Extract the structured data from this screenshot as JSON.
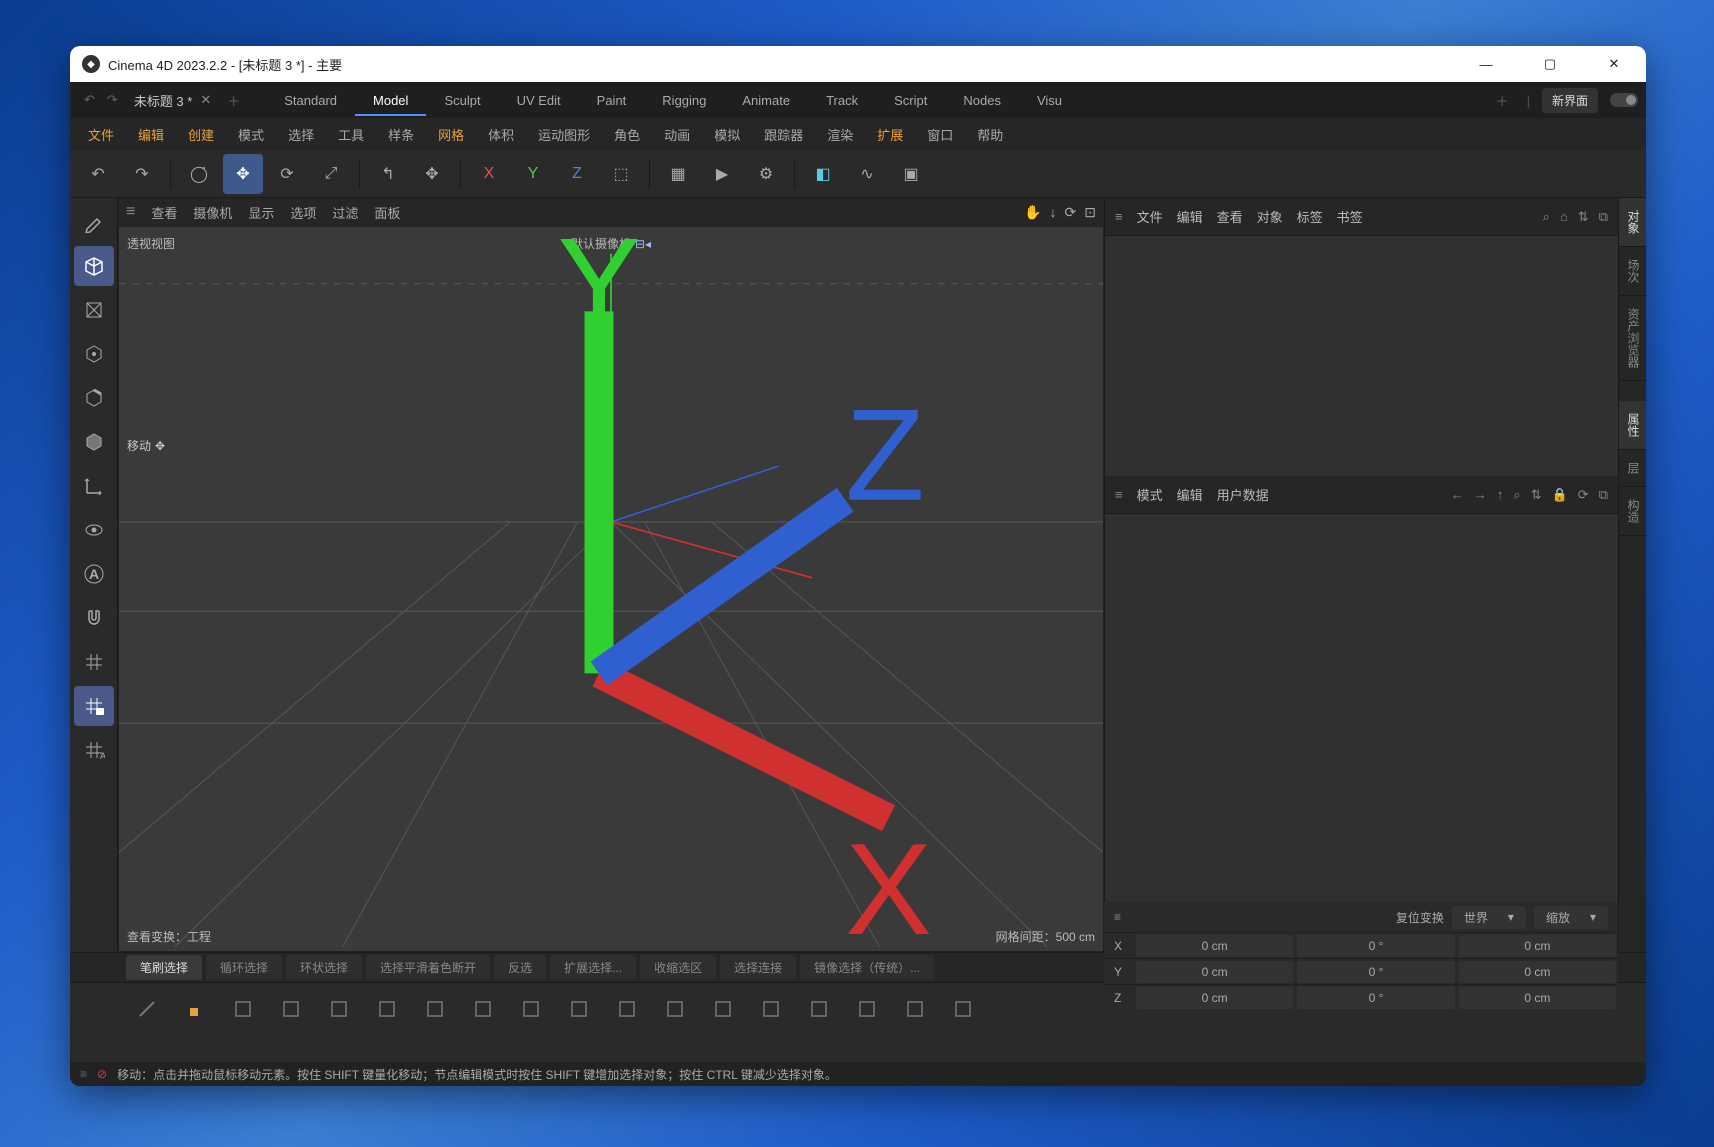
{
  "titlebar": {
    "title": "Cinema 4D 2023.2.2 - [未标题 3 *] - 主要"
  },
  "topTabs": {
    "fileTab": "未标题 3 *",
    "items": [
      "Standard",
      "Model",
      "Sculpt",
      "UV Edit",
      "Paint",
      "Rigging",
      "Animate",
      "Track",
      "Script",
      "Nodes",
      "Visu"
    ],
    "activeIndex": 1,
    "newUiLabel": "新界面"
  },
  "menubar": {
    "items": [
      "文件",
      "编辑",
      "创建",
      "模式",
      "选择",
      "工具",
      "样条",
      "网格",
      "体积",
      "运动图形",
      "角色",
      "动画",
      "模拟",
      "跟踪器",
      "渲染",
      "扩展",
      "窗口",
      "帮助"
    ],
    "orangeIndices": [
      0,
      1,
      2,
      7,
      15
    ]
  },
  "toolbar": {
    "buttons": [
      {
        "name": "undo",
        "glyph": "↶"
      },
      {
        "name": "redo",
        "glyph": "↷"
      },
      {
        "name": "sep"
      },
      {
        "name": "live-select",
        "glyph": "◯̇"
      },
      {
        "name": "move",
        "glyph": "✥",
        "active": true
      },
      {
        "name": "rotate",
        "glyph": "⟳"
      },
      {
        "name": "scale",
        "glyph": "⤢"
      },
      {
        "name": "sep"
      },
      {
        "name": "last-tool",
        "glyph": "↰"
      },
      {
        "name": "axis-move",
        "glyph": "✥"
      },
      {
        "name": "sep"
      },
      {
        "name": "x-axis",
        "glyph": "X",
        "cls": "axis-x"
      },
      {
        "name": "y-axis",
        "glyph": "Y",
        "cls": "axis-y"
      },
      {
        "name": "z-axis",
        "glyph": "Z",
        "cls": "axis-z"
      },
      {
        "name": "coord-system",
        "glyph": "⬚"
      },
      {
        "name": "sep"
      },
      {
        "name": "render-view",
        "glyph": "▦"
      },
      {
        "name": "render-region",
        "glyph": "▶"
      },
      {
        "name": "render-settings",
        "glyph": "⚙"
      },
      {
        "name": "sep"
      },
      {
        "name": "cube-primitive",
        "glyph": "◧",
        "cls": "prim"
      },
      {
        "name": "spline-primitive",
        "glyph": "∿"
      },
      {
        "name": "generator",
        "glyph": "▣"
      }
    ]
  },
  "leftToolbar": {
    "items": [
      {
        "name": "make-editable",
        "svg": "pen"
      },
      {
        "name": "model-mode",
        "svg": "cube",
        "active": true
      },
      {
        "name": "texture-mode",
        "svg": "texture"
      },
      {
        "name": "point-mode",
        "svg": "hex-point"
      },
      {
        "name": "edge-mode",
        "svg": "hex-edge"
      },
      {
        "name": "polygon-mode",
        "svg": "hex-poly"
      },
      {
        "name": "axis-mode",
        "svg": "axis"
      },
      {
        "name": "viewport-solo",
        "svg": "eye"
      },
      {
        "name": "auto-switch",
        "svg": "A"
      },
      {
        "name": "snap",
        "svg": "magnet"
      },
      {
        "name": "workplane",
        "svg": "grid"
      },
      {
        "name": "workplane-lock",
        "svg": "grid-lock",
        "active": true
      },
      {
        "name": "workplane-auto",
        "svg": "grid-a"
      }
    ]
  },
  "viewportMenu": {
    "items": [
      "查看",
      "摄像机",
      "显示",
      "选项",
      "过滤",
      "面板"
    ]
  },
  "viewport": {
    "labelTL": "透视视图",
    "labelTC": "默认摄像机",
    "moveLabel": "移动",
    "labelBL": "查看变换：工程",
    "labelBR": "网格间距：500 cm"
  },
  "objectPanel": {
    "menu": [
      "文件",
      "编辑",
      "查看",
      "对象",
      "标签",
      "书签"
    ]
  },
  "attrPanel": {
    "menu": [
      "模式",
      "编辑",
      "用户数据"
    ]
  },
  "sideTabs": {
    "top": [
      "对象",
      "场次",
      "资产浏览器"
    ],
    "bottom": [
      "属性",
      "层",
      "构造"
    ]
  },
  "selectionTabs": {
    "items": [
      "笔刷选择",
      "循环选择",
      "环状选择",
      "选择平滑着色断开",
      "反选",
      "扩展选择...",
      "收缩选区",
      "选择连接",
      "镜像选择（传统）..."
    ],
    "activeIndex": 0
  },
  "coordPanel": {
    "resetLabel": "复位变换",
    "system": "世界",
    "mode": "缩放",
    "rows": [
      {
        "axis": "X",
        "pos": "0 cm",
        "rot": "0 °",
        "scale": "0 cm"
      },
      {
        "axis": "Y",
        "pos": "0 cm",
        "rot": "0 °",
        "scale": "0 cm"
      },
      {
        "axis": "Z",
        "pos": "0 cm",
        "rot": "0 °",
        "scale": "0 cm"
      }
    ]
  },
  "statusbar": {
    "text": "移动：点击并拖动鼠标移动元素。按住 SHIFT 键量化移动；节点编辑模式时按住 SHIFT 键增加选择对象；按住 CTRL 键减少选择对象。"
  }
}
